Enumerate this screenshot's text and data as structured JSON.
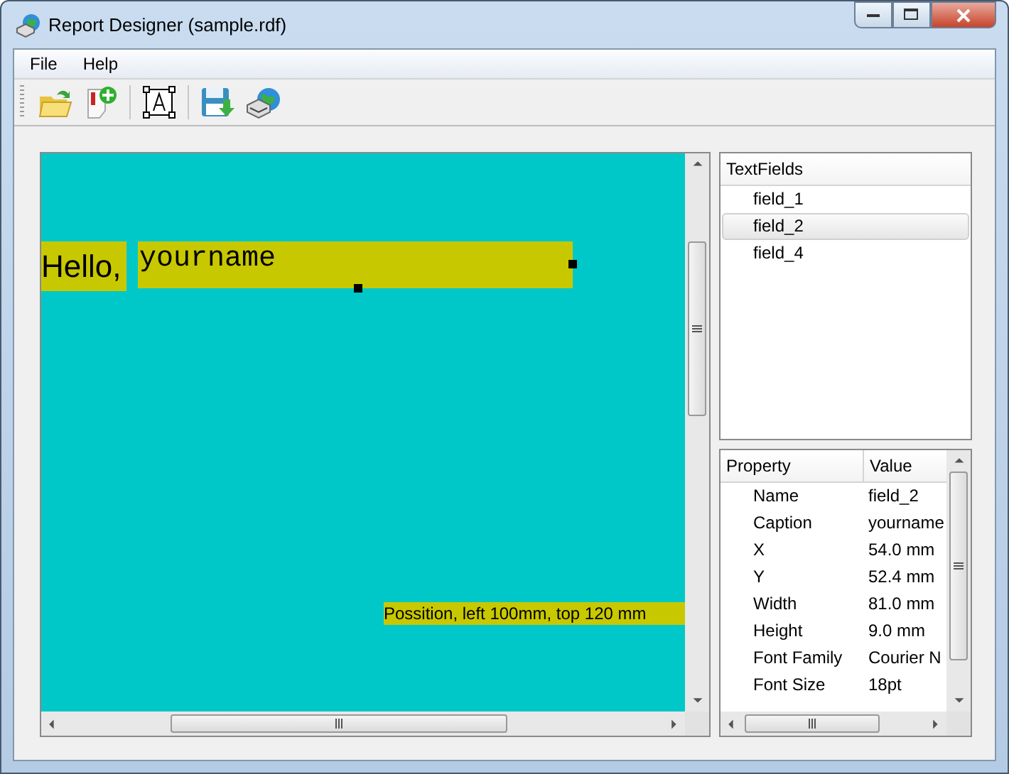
{
  "window": {
    "title": "Report Designer (sample.rdf)"
  },
  "menu": [
    "File",
    "Help"
  ],
  "canvas_items": [
    {
      "kind": "label",
      "text": "Hello,",
      "selected": false
    },
    {
      "kind": "field",
      "text": "yourname",
      "selected": true
    },
    {
      "kind": "note",
      "text": "Possition, left 100mm, top 120 mm",
      "selected": false
    }
  ],
  "text_fields": {
    "header": "TextFields",
    "items": [
      {
        "label": "field_1",
        "selected": false
      },
      {
        "label": "field_2",
        "selected": true
      },
      {
        "label": "field_4",
        "selected": false
      }
    ]
  },
  "properties": {
    "columns": [
      "Property",
      "Value"
    ],
    "rows": [
      {
        "name": "Name",
        "value": "field_2"
      },
      {
        "name": "Caption",
        "value": "yourname"
      },
      {
        "name": "X",
        "value": "54.0 mm"
      },
      {
        "name": "Y",
        "value": "52.4 mm"
      },
      {
        "name": "Width",
        "value": "81.0 mm"
      },
      {
        "name": "Height",
        "value": "9.0 mm"
      },
      {
        "name": "Font Family",
        "value": "Courier N"
      },
      {
        "name": "Font Size",
        "value": "18pt"
      }
    ]
  }
}
